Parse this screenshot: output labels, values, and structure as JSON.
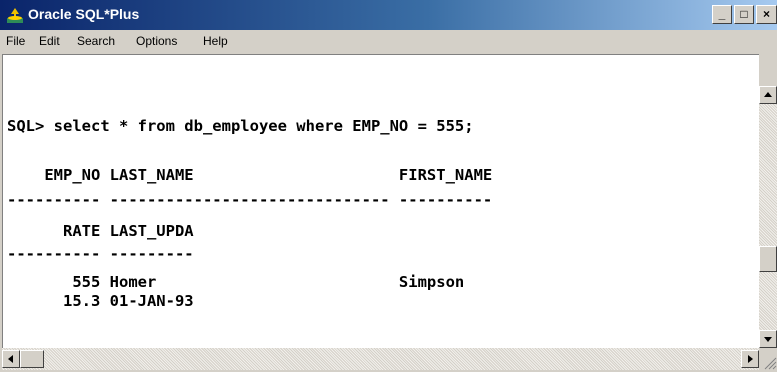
{
  "window": {
    "title": "Oracle SQL*Plus"
  },
  "titlebar": {
    "minimize": "_",
    "maximize": "□",
    "close": "×"
  },
  "menu": {
    "file": "File",
    "edit": "Edit",
    "search": "Search",
    "options": "Options",
    "help": "Help"
  },
  "console": {
    "lines": [
      "SQL> select * from db_employee where EMP_NO = 555;",
      "",
      "    EMP_NO LAST_NAME                      FIRST_NAME",
      "---------- ------------------------------ ----------",
      "      RATE LAST_UPDA",
      "---------- ---------",
      "       555 Homer                          Simpson",
      "      15.3 01-JAN-93"
    ]
  },
  "icons": {
    "app": "oracle-app-icon",
    "scroll_up": "arrow-up-icon",
    "scroll_down": "arrow-down-icon",
    "scroll_left": "arrow-left-icon",
    "scroll_right": "arrow-right-icon",
    "size_grip": "size-grip-icon"
  },
  "colors": {
    "titlebar_start": "#0a246a",
    "titlebar_end": "#a6caf0",
    "console_bg": "#ffffff",
    "chrome": "#d4d0c8"
  }
}
